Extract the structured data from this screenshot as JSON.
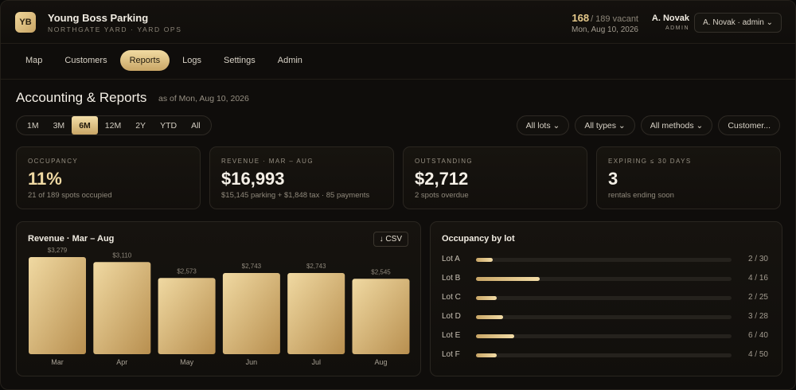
{
  "header": {
    "logo_text": "YB",
    "app_name": "Young Boss Parking",
    "subtitle": "NORTHGATE YARD · YARD OPS",
    "vacant_count": "168",
    "vacant_suffix": "/ 189 vacant",
    "date": "Mon, Aug 10, 2026",
    "user_name": "A. Novak",
    "user_role": "ADMIN",
    "user_select": "A. Novak · admin ⌄"
  },
  "nav": {
    "items": [
      {
        "label": "Map"
      },
      {
        "label": "Customers"
      },
      {
        "label": "Reports",
        "active": true
      },
      {
        "label": "Logs"
      },
      {
        "label": "Settings"
      },
      {
        "label": "Admin"
      }
    ]
  },
  "page": {
    "title": "Accounting & Reports",
    "as_of": "as of Mon, Aug 10, 2026"
  },
  "range": {
    "items": [
      "1M",
      "3M",
      "6M",
      "12M",
      "2Y",
      "YTD",
      "All"
    ],
    "selected": "6M"
  },
  "filters": [
    "All lots ⌄",
    "All types ⌄",
    "All methods ⌄",
    "Customer..."
  ],
  "kpis": [
    {
      "label": "OCCUPANCY",
      "value": "11%",
      "sub": "21 of 189 spots occupied",
      "gold": true
    },
    {
      "label": "REVENUE · MAR – AUG",
      "value": "$16,993",
      "sub": "$15,145 parking + $1,848 tax · 85 payments",
      "gold": false
    },
    {
      "label": "OUTSTANDING",
      "value": "$2,712",
      "sub": "2 spots overdue",
      "gold": false
    },
    {
      "label": "EXPIRING ≤ 30 DAYS",
      "value": "3",
      "sub": "rentals ending soon",
      "gold": false
    }
  ],
  "revenue_panel": {
    "title": "Revenue · Mar – Aug",
    "csv_label": "↓ CSV"
  },
  "chart_data": {
    "type": "bar",
    "title": "Revenue · Mar – Aug",
    "categories": [
      "Mar",
      "Apr",
      "May",
      "Jun",
      "Jul",
      "Aug"
    ],
    "values": [
      3279,
      3110,
      2573,
      2743,
      2743,
      2545
    ],
    "value_labels": [
      "$3,279",
      "$3,110",
      "$2,573",
      "$2,743",
      "$2,743",
      "$2,545"
    ],
    "ylim": [
      0,
      3279
    ],
    "grid": false,
    "colors": {
      "bar_top": "#f0d9a2",
      "bar_bottom": "#b88f4f"
    }
  },
  "occupancy_panel": {
    "title": "Occupancy by lot",
    "lots": [
      {
        "name": "Lot A",
        "occupied": 2,
        "total": 30,
        "label": "2 / 30"
      },
      {
        "name": "Lot B",
        "occupied": 4,
        "total": 16,
        "label": "4 / 16"
      },
      {
        "name": "Lot C",
        "occupied": 2,
        "total": 25,
        "label": "2 / 25"
      },
      {
        "name": "Lot D",
        "occupied": 3,
        "total": 28,
        "label": "3 / 28"
      },
      {
        "name": "Lot E",
        "occupied": 6,
        "total": 40,
        "label": "6 / 40"
      },
      {
        "name": "Lot F",
        "occupied": 4,
        "total": 50,
        "label": "4 / 50"
      }
    ]
  },
  "colors": {
    "accent_gold": "#e5c98b",
    "background": "#0f0d0b"
  }
}
